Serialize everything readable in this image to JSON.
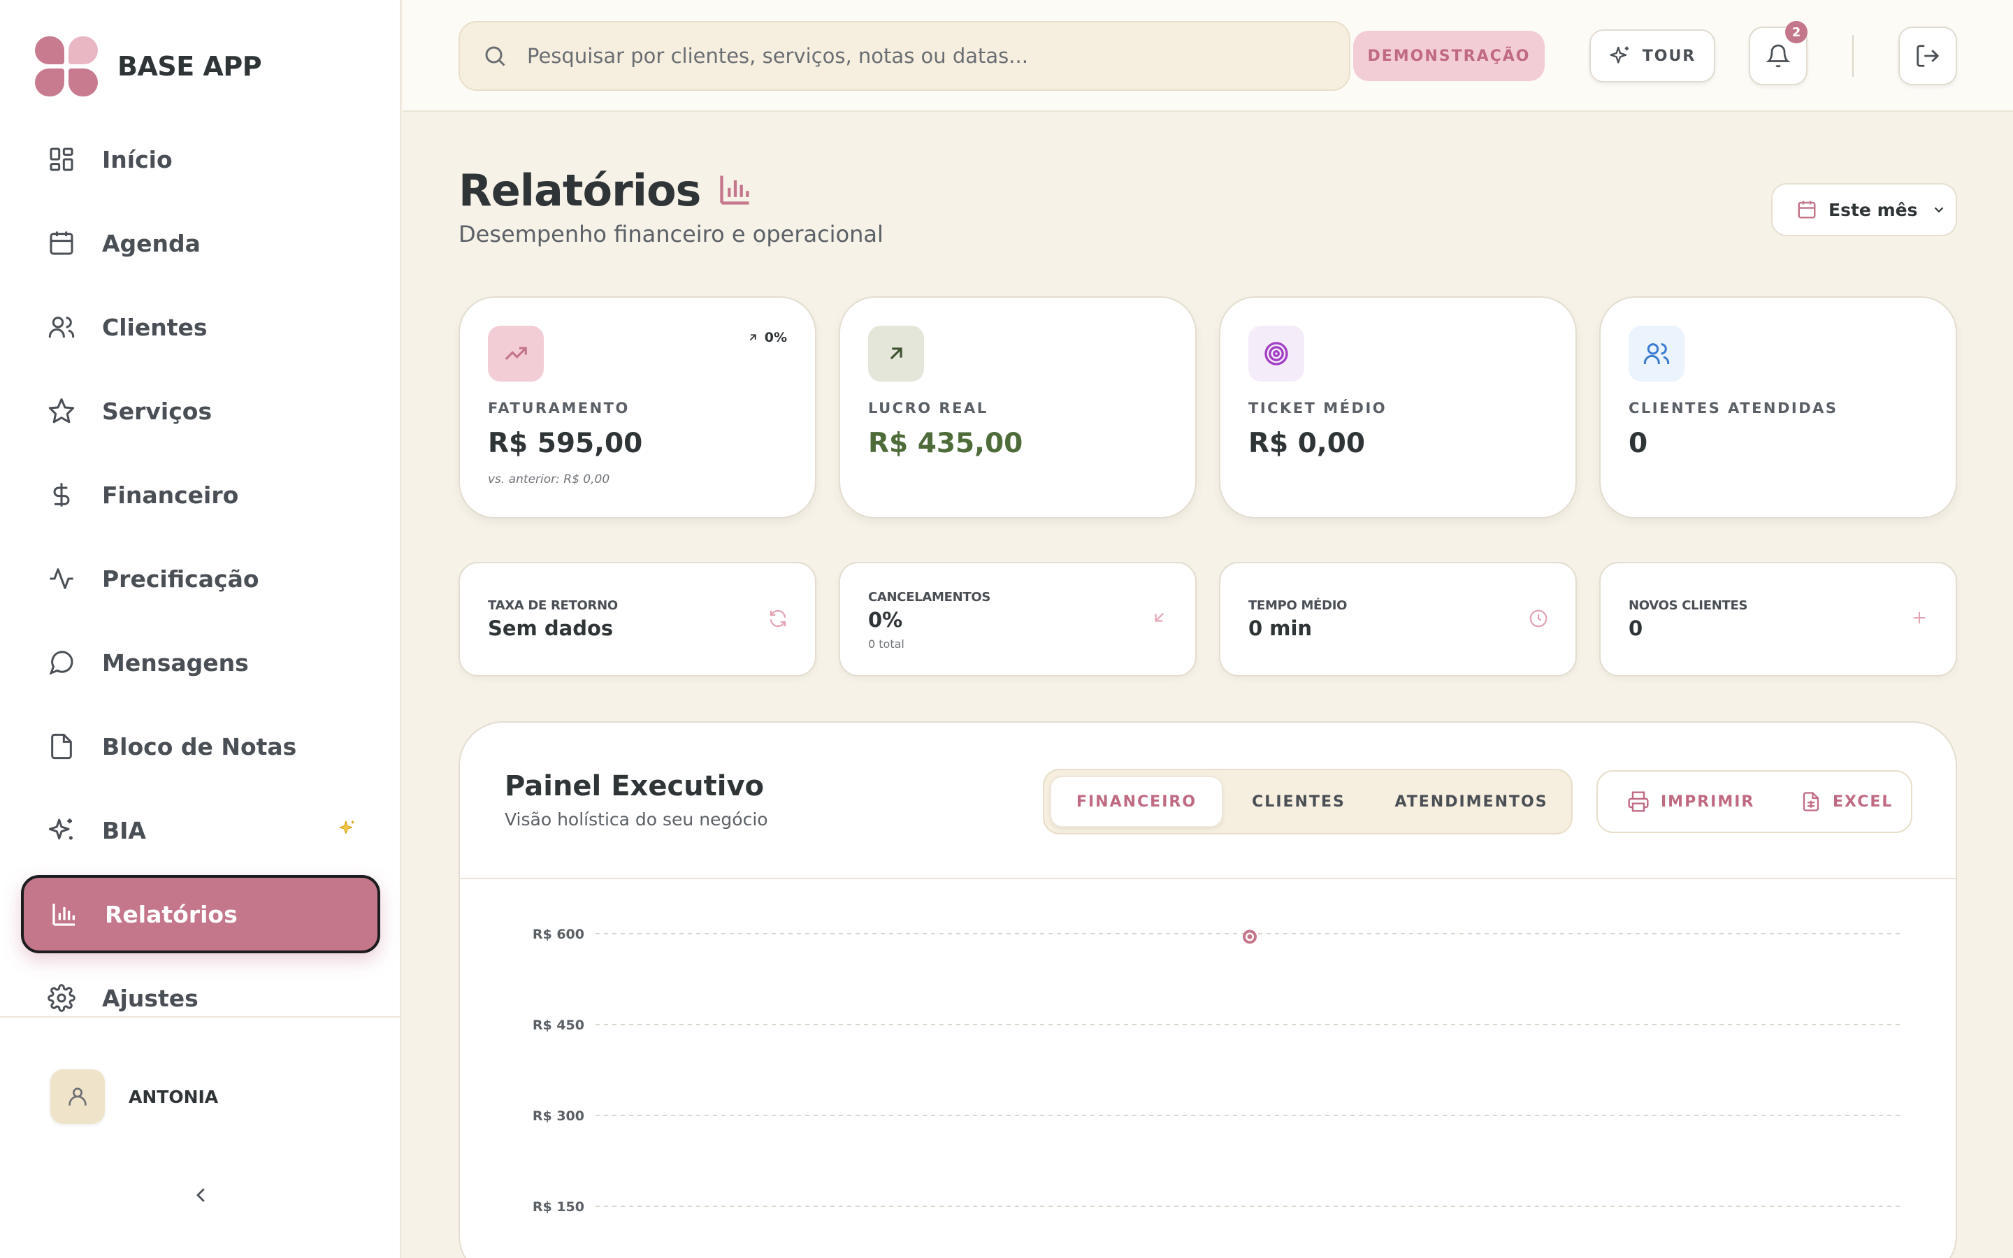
{
  "app": {
    "name": "BASE APP"
  },
  "sidebar": {
    "items": [
      {
        "label": "Início",
        "icon": "dashboard-grid-icon"
      },
      {
        "label": "Agenda",
        "icon": "calendar-icon"
      },
      {
        "label": "Clientes",
        "icon": "users-icon"
      },
      {
        "label": "Serviços",
        "icon": "star-icon"
      },
      {
        "label": "Financeiro",
        "icon": "dollar-icon"
      },
      {
        "label": "Precificação",
        "icon": "activity-icon"
      },
      {
        "label": "Mensagens",
        "icon": "message-circle-icon"
      },
      {
        "label": "Bloco de Notas",
        "icon": "file-icon"
      },
      {
        "label": "BIA",
        "icon": "sparkles-icon"
      },
      {
        "label": "Relatórios",
        "icon": "bar-chart-icon",
        "active": true
      },
      {
        "label": "Ajustes",
        "icon": "gear-icon"
      }
    ],
    "user": {
      "name": "ANTONIA"
    }
  },
  "topbar": {
    "search_placeholder": "Pesquisar por clientes, serviços, notas ou datas...",
    "demo_label": "DEMONSTRAÇÃO",
    "tour_label": "TOUR",
    "notification_count": "2"
  },
  "page": {
    "title": "Relatórios",
    "subtitle": "Desempenho financeiro e operacional",
    "period": "Este mês"
  },
  "kpis": {
    "faturamento": {
      "label": "FATURAMENTO",
      "value": "R$ 595,00",
      "trend": "0%",
      "note": "vs. anterior: R$ 0,00"
    },
    "lucro": {
      "label": "LUCRO REAL",
      "value": "R$ 435,00"
    },
    "ticket": {
      "label": "TICKET MÉDIO",
      "value": "R$ 0,00"
    },
    "clientes": {
      "label": "CLIENTES ATENDIDAS",
      "value": "0"
    }
  },
  "stats": {
    "retorno": {
      "label": "TAXA DE RETORNO",
      "value": "Sem dados"
    },
    "cancelamentos": {
      "label": "CANCELAMENTOS",
      "value": "0%",
      "sub": "0 total"
    },
    "tempo": {
      "label": "TEMPO MÉDIO",
      "value": "0 min"
    },
    "novos": {
      "label": "NOVOS CLIENTES",
      "value": "0"
    }
  },
  "panel": {
    "title": "Painel Executivo",
    "subtitle": "Visão holística do seu negócio",
    "tabs": [
      "FINANCEIRO",
      "CLIENTES",
      "ATENDIMENTOS"
    ],
    "print_label": "IMPRIMIR",
    "excel_label": "EXCEL"
  },
  "colors": {
    "accent": "#c4768b",
    "profit": "#4e6b3a",
    "background": "#f6f2e8"
  },
  "chart_data": {
    "type": "line",
    "y_ticks": [
      "R$ 600",
      "R$ 450",
      "R$ 300",
      "R$ 150"
    ],
    "ylim": [
      0,
      600
    ],
    "series": [
      {
        "values": [
          595
        ]
      }
    ],
    "grid": true
  }
}
